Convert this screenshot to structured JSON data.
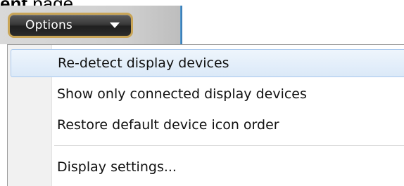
{
  "page_text": {
    "suffix": "page.",
    "emphasis": "ent"
  },
  "options_button": {
    "label": "Options",
    "icon": "chevron-down-icon"
  },
  "menu": {
    "items": [
      {
        "label": "Re-detect display devices",
        "state": "highlighted"
      },
      {
        "label": "Show only connected display devices"
      },
      {
        "label": "Restore default device icon order"
      },
      {
        "label": "Display settings..."
      }
    ]
  },
  "colors": {
    "button_border": "#c9a557",
    "highlight_border": "#a9c9ee",
    "highlight_fill": "#dbe9f8"
  }
}
